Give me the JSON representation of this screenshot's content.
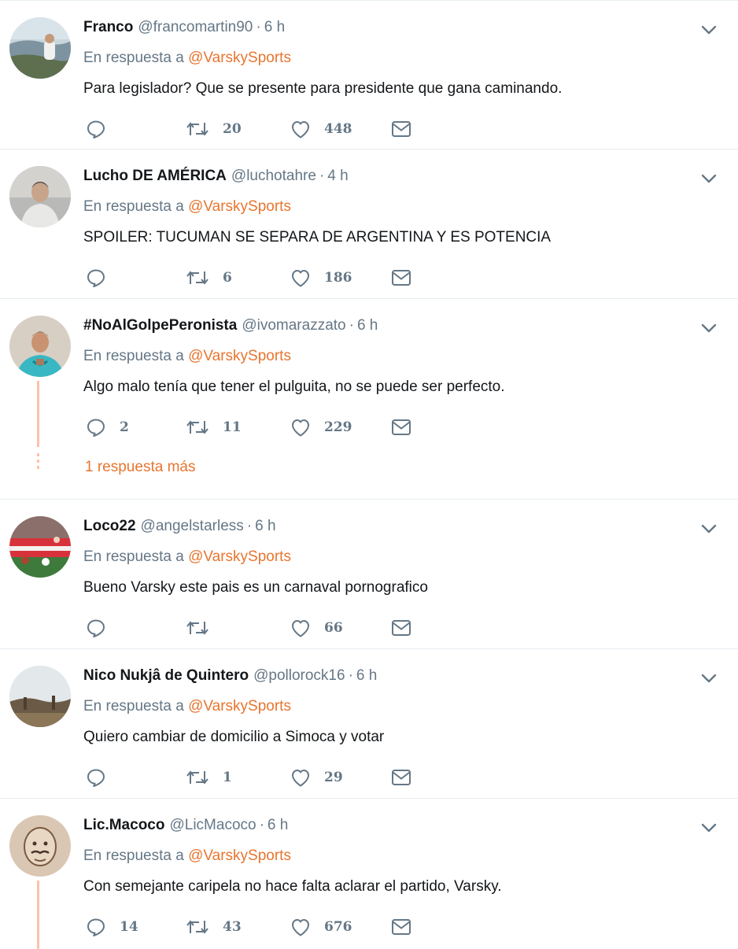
{
  "reply_prefix": "En respuesta a",
  "tweets": [
    {
      "name": "Franco",
      "handle": "@francomartin90",
      "time": "6 h",
      "reply_to": "@VarskySports",
      "text": "Para legislador? Que se presente para presidente que gana caminando.",
      "replies": "",
      "retweets": "20",
      "likes": "448"
    },
    {
      "name": "Lucho DE AMÉRICA",
      "handle": "@luchotahre",
      "time": "4 h",
      "reply_to": "@VarskySports",
      "text": "SPOILER: TUCUMAN SE SEPARA DE ARGENTINA Y ES POTENCIA",
      "replies": "",
      "retweets": "6",
      "likes": "186"
    },
    {
      "name": "#NoAlGolpePeronista",
      "handle": "@ivomarazzato",
      "time": "6 h",
      "reply_to": "@VarskySports",
      "text": "Algo malo tenía que tener el pulguita, no se puede ser perfecto.",
      "replies": "2",
      "retweets": "11",
      "likes": "229",
      "more_replies": "1 respuesta más"
    },
    {
      "name": "Loco22",
      "handle": "@angelstarless",
      "time": "6 h",
      "reply_to": "@VarskySports",
      "text": "Bueno Varsky este pais es un carnaval pornografico",
      "replies": "",
      "retweets": "",
      "likes": "66"
    },
    {
      "name": "Nico Nukjâ de Quintero",
      "handle": "@pollorock16",
      "time": "6 h",
      "reply_to": "@VarskySports",
      "text": "Quiero cambiar de domicilio a Simoca y votar",
      "replies": "",
      "retweets": "1",
      "likes": "29"
    },
    {
      "name": "Lic.Macoco",
      "handle": "@LicMacoco",
      "time": "6 h",
      "reply_to": "@VarskySports",
      "text": "Con semejante caripela no hace falta aclarar el partido, Varsky.",
      "replies": "14",
      "retweets": "43",
      "likes": "676"
    }
  ],
  "colors": {
    "accent": "#e8752f",
    "muted": "#657786",
    "thread": "#fdc2a8",
    "divider": "#e6ecf0"
  },
  "icons": [
    "chevron-down-icon",
    "reply-icon",
    "retweet-icon",
    "like-icon",
    "direct-message-icon"
  ]
}
